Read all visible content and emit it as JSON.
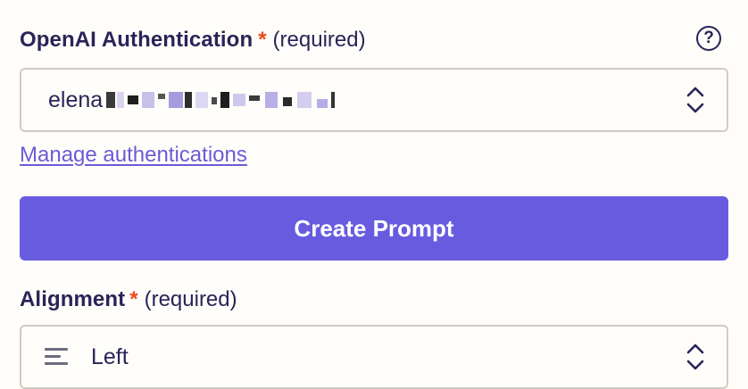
{
  "auth_field": {
    "label": "OpenAI Authentication",
    "required_star": "*",
    "required_text": "(required)",
    "help_icon": "question-circle-icon",
    "help_glyph": "?",
    "value_visible": "elena",
    "value_redacted": true,
    "dropdown_icon": "chevron-up-down-icon"
  },
  "manage_link": {
    "label": "Manage authentications"
  },
  "create_button": {
    "label": "Create Prompt",
    "color": "#695be0"
  },
  "alignment_field": {
    "label": "Alignment",
    "required_star": "*",
    "required_text": "(required)",
    "value": "Left",
    "value_icon": "align-left-icon",
    "dropdown_icon": "chevron-up-down-icon"
  },
  "colors": {
    "text": "#2b2358",
    "required": "#e8491d",
    "link": "#6a5bd8",
    "border": "#cfcbc3",
    "background": "#fffdf9"
  }
}
